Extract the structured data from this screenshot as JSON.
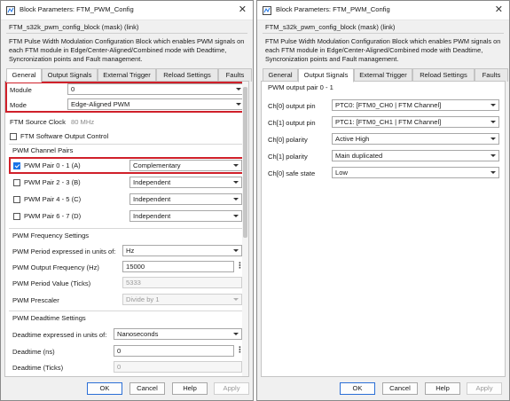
{
  "left": {
    "title": "Block Parameters: FTM_PWM_Config",
    "block_name": "FTM_s32k_pwm_config_block (mask) (link)",
    "description": "FTM Pulse Width Modulation Configuration Block which enables PWM signals on each FTM module in Edge/Center-Aligned/Combined mode with Deadtime, Syncronization points and Fault management.",
    "tabs": [
      "General",
      "Output Signals",
      "External Trigger",
      "Reload Settings",
      "Faults"
    ],
    "active_tab": "General",
    "module": {
      "label": "Module",
      "value": "0"
    },
    "mode": {
      "label": "Mode",
      "value": "Edge-Aligned PWM"
    },
    "source_clock": {
      "label": "FTM Source Clock",
      "value": "80 MHz"
    },
    "sw_output_control": {
      "label": "FTM Software Output Control",
      "checked": false
    },
    "channel_pairs": {
      "heading": "PWM Channel Pairs",
      "pairs": [
        {
          "label": "PWM Pair 0 - 1 (A)",
          "checked": true,
          "value": "Complementary"
        },
        {
          "label": "PWM Pair 2 - 3 (B)",
          "checked": false,
          "value": "Independent"
        },
        {
          "label": "PWM Pair 4 - 5 (C)",
          "checked": false,
          "value": "Independent"
        },
        {
          "label": "PWM Pair 6 - 7 (D)",
          "checked": false,
          "value": "Independent"
        }
      ]
    },
    "frequency": {
      "heading": "PWM Frequency Settings",
      "period_units": {
        "label": "PWM Period expressed in units of:",
        "value": "Hz"
      },
      "output_frequency": {
        "label": "PWM Output Frequency (Hz)",
        "value": "15000"
      },
      "period_value": {
        "label": "PWM Period Value (Ticks)",
        "value": "5333"
      },
      "prescaler": {
        "label": "PWM Prescaler",
        "value": "Divide by 1"
      }
    },
    "deadtime": {
      "heading": "PWM Deadtime Settings",
      "units": {
        "label": "Deadtime expressed in units of:",
        "value": "Nanoseconds"
      },
      "ns": {
        "label": "Deadtime (ns)",
        "value": "0"
      },
      "ticks": {
        "label": "Deadtime (Ticks)",
        "value": "0"
      }
    },
    "buttons": {
      "ok": "OK",
      "cancel": "Cancel",
      "help": "Help",
      "apply": "Apply"
    }
  },
  "right": {
    "title": "Block Parameters: FTM_PWM_Config",
    "block_name": "FTM_s32k_pwm_config_block (mask) (link)",
    "description": "FTM Pulse Width Modulation Configuration Block which enables PWM signals on each FTM module in Edge/Center-Aligned/Combined mode with Deadtime, Syncronization points and Fault management.",
    "tabs": [
      "General",
      "Output Signals",
      "External Trigger",
      "Reload Settings",
      "Faults"
    ],
    "active_tab": "Output Signals",
    "group_heading": "PWM output pair 0 - 1",
    "rows": [
      {
        "label": "Ch[0] output pin",
        "value": "PTC0: [FTM0_CH0 | FTM Channel]"
      },
      {
        "label": "Ch[1] output pin",
        "value": "PTC1: [FTM0_CH1 | FTM Channel]"
      },
      {
        "label": "Ch[0] polarity",
        "value": "Active High"
      },
      {
        "label": "Ch[1] polarity",
        "value": "Main duplicated"
      },
      {
        "label": "Ch[0] safe state",
        "value": "Low"
      }
    ],
    "buttons": {
      "ok": "OK",
      "cancel": "Cancel",
      "help": "Help",
      "apply": "Apply"
    }
  },
  "colors": {
    "highlight": "#d0202a",
    "accent": "#1a73e8"
  }
}
